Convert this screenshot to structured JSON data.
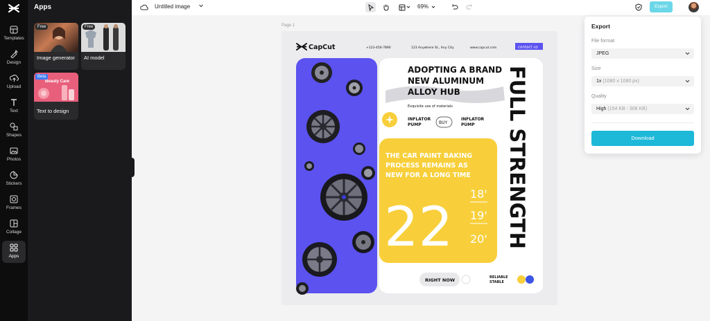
{
  "rail": {
    "items": [
      {
        "label": "Templates",
        "icon": "templates-icon"
      },
      {
        "label": "Design",
        "icon": "design-icon"
      },
      {
        "label": "Upload",
        "icon": "upload-icon"
      },
      {
        "label": "Text",
        "icon": "text-icon"
      },
      {
        "label": "Shapes",
        "icon": "shapes-icon"
      },
      {
        "label": "Photos",
        "icon": "photos-icon"
      },
      {
        "label": "Stickers",
        "icon": "stickers-icon"
      },
      {
        "label": "Frames",
        "icon": "frames-icon"
      },
      {
        "label": "Collage",
        "icon": "collage-icon"
      },
      {
        "label": "Apps",
        "icon": "apps-icon"
      }
    ]
  },
  "panel": {
    "title": "Apps",
    "cards": [
      {
        "label": "Image generator",
        "tag": "Free"
      },
      {
        "label": "AI model",
        "tag": "Free"
      },
      {
        "label": "Text to design",
        "tag": "Beta",
        "thumb_text": "Beauty Care"
      }
    ]
  },
  "topbar": {
    "title": "Untitled image",
    "zoom": "69%",
    "export_label": "Export"
  },
  "canvas": {
    "page_label": "Page 1",
    "design": {
      "brand": "CapCut",
      "phone": "+123-456-7890",
      "address": "123 Anywhere St., Any City",
      "website": "www.capcut.com",
      "contact": "contact us",
      "headline_1": "ADOPTING A BRAND",
      "headline_2": "NEW ALUMINUM",
      "headline_3": "ALLOY HUB",
      "subline": "Exquisite use of materials",
      "pump_left_1": "INFLATOR",
      "pump_left_2": "PUMP",
      "buy": "BUY",
      "pump_right_1": "INFLATOR",
      "pump_right_2": "PUMP",
      "paint_1": "THE CAR PAINT BAKING",
      "paint_2": "PROCESS REMAINS AS",
      "paint_3": "NEW FOR A LONG TIME",
      "big_number": "22",
      "size_1": "18'",
      "size_2": "19'",
      "size_3": "20'",
      "vertical": "FULL STRENGTH",
      "right_now": "RIGHT NOW",
      "reliable_1": "RELIABLE",
      "reliable_2": "STABLE"
    }
  },
  "export": {
    "title": "Export",
    "format_label": "File format",
    "format_value": "JPEG",
    "size_label": "Size",
    "size_value": "1x",
    "size_hint": "(1080 x 1080 px)",
    "quality_label": "Quality",
    "quality_value": "High",
    "quality_hint": "(154 KB - 308 KB)",
    "download_label": "Download"
  },
  "colors": {
    "accent": "#1eb8d8",
    "export_button": "#6bd7e8",
    "design_blue": "#5b52f0",
    "design_yellow": "#f8cf3a"
  }
}
